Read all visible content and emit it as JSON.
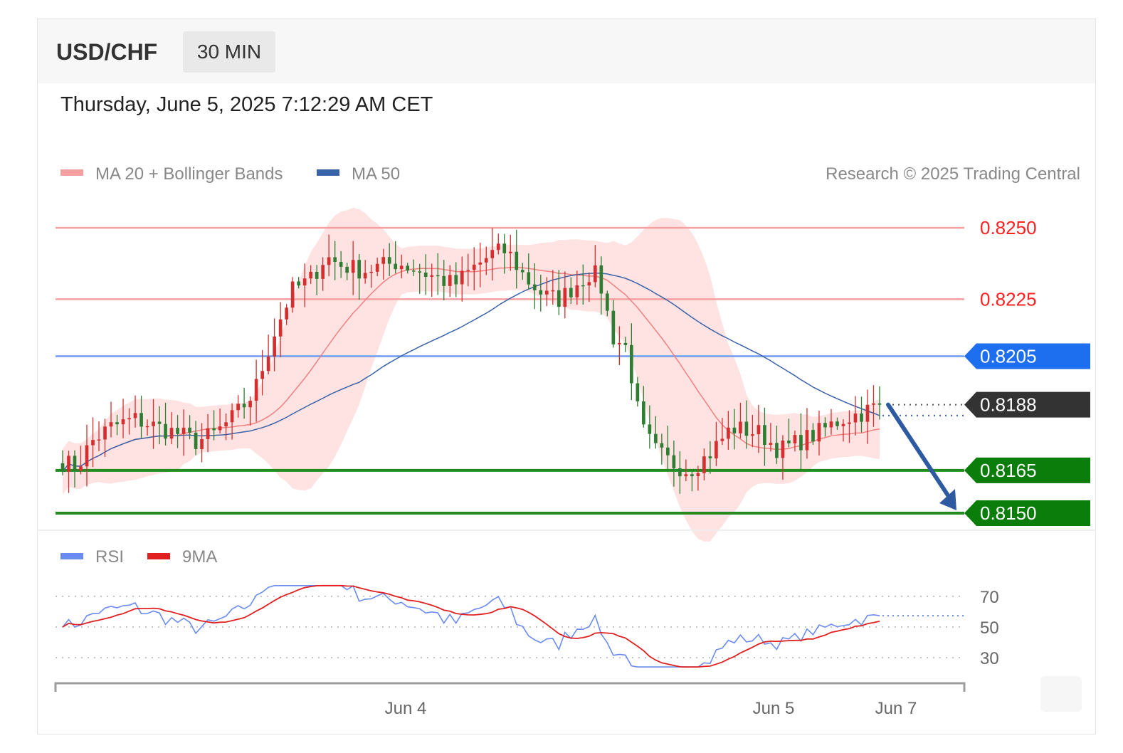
{
  "header": {
    "symbol": "USD/CHF",
    "timeframe": "30 MIN",
    "datetime": "Thursday, June 5, 2025 7:12:29 AM CET"
  },
  "legend": {
    "ma20_label": "MA 20 + Bollinger Bands",
    "ma50_label": "MA 50",
    "credit": "Research © 2025 Trading Central",
    "rsi_label": "RSI",
    "rsi_ma_label": "9MA"
  },
  "colors": {
    "up_candle": "#d32f2f",
    "down_candle": "#2e7d32",
    "band_fill": "#ffdfdf",
    "ma20": "#f08080",
    "ma50": "#3a63a8",
    "resistance": "#f5a0a0",
    "pivot": "#6e9cf0",
    "support": "#228b22",
    "current": "#333333",
    "arrow": "#2d5aa0",
    "rsi": "#6a8cf0",
    "rsi_ma": "#e02020"
  },
  "chart_data": {
    "type": "candlestick",
    "ylim": [
      0.8146,
      0.8264
    ],
    "levels": [
      {
        "value": 0.825,
        "label": "0.8250",
        "kind": "resistance"
      },
      {
        "value": 0.8225,
        "label": "0.8225",
        "kind": "resistance"
      },
      {
        "value": 0.8205,
        "label": "0.8205",
        "kind": "pivot"
      },
      {
        "value": 0.8188,
        "label": "0.8188",
        "kind": "current"
      },
      {
        "value": 0.8165,
        "label": "0.8165",
        "kind": "support"
      },
      {
        "value": 0.815,
        "label": "0.8150",
        "kind": "support"
      }
    ],
    "x_ticks": [
      "Jun 4",
      "Jun 5",
      "Jun 7"
    ],
    "projection": {
      "from": 0.8188,
      "to": 0.815
    },
    "rsi": {
      "ticks": [
        70,
        50,
        30
      ],
      "ylim": [
        18,
        82
      ],
      "levels": [
        70,
        50,
        30
      ]
    }
  }
}
